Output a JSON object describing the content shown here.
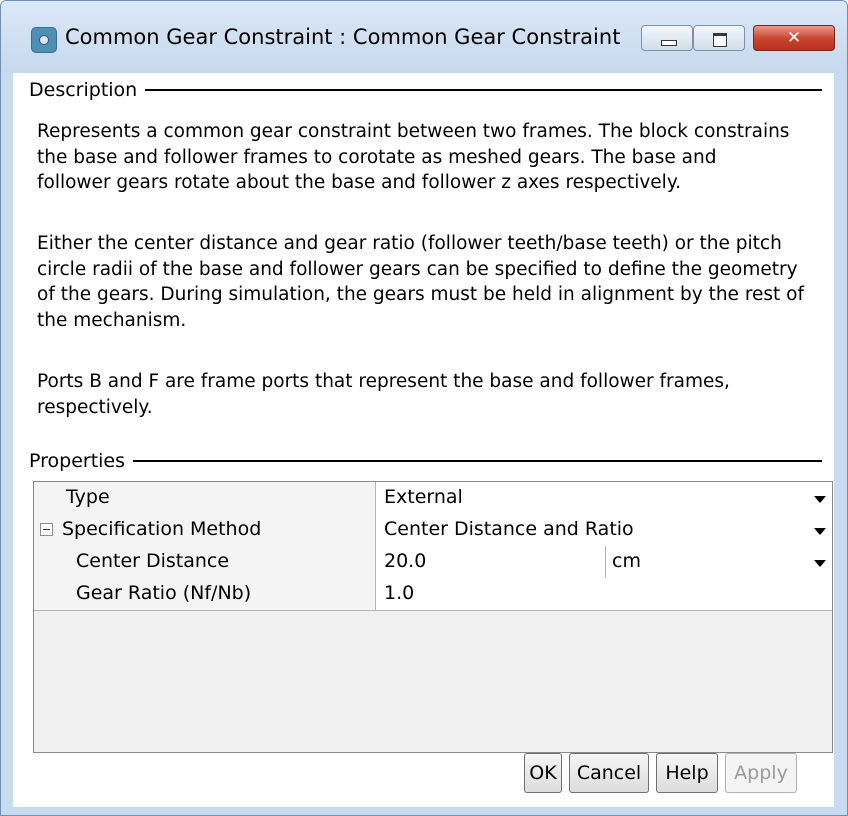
{
  "window": {
    "title": "Common Gear Constraint : Common Gear Constraint",
    "icon": "simscape-block-icon"
  },
  "description": {
    "header": "Description",
    "paragraphs": [
      [
        "Represents a common gear constraint between two frames. The block constrains",
        "the base and follower frames to corotate as meshed gears. The base and",
        "follower gears rotate about the base and follower z axes respectively."
      ],
      [
        "Either the center distance and gear ratio (follower teeth/base teeth) or the pitch",
        "circle radii of the base and follower gears can be specified to define the geometry",
        "of the gears. During simulation, the gears must be held in alignment by the rest of",
        "the mechanism."
      ],
      [
        "Ports B and F are frame ports that represent the base and follower frames,",
        "respectively."
      ]
    ]
  },
  "properties": {
    "header": "Properties",
    "rows": [
      {
        "label": "Type",
        "value": "External",
        "dropdown": true
      },
      {
        "label": "Specification Method",
        "value": "Center Distance and Ratio",
        "dropdown": true,
        "collapsible": true
      },
      {
        "label": "Center Distance",
        "value": "20.0",
        "unit": "cm",
        "dropdown": true
      },
      {
        "label": "Gear Ratio (Nf/Nb)",
        "value": "1.0"
      }
    ]
  },
  "buttons": {
    "ok": "OK",
    "cancel": "Cancel",
    "help": "Help",
    "apply": "Apply"
  },
  "colors": {
    "title_bar": "#c7d9ee",
    "close_button": "#c8422c"
  }
}
